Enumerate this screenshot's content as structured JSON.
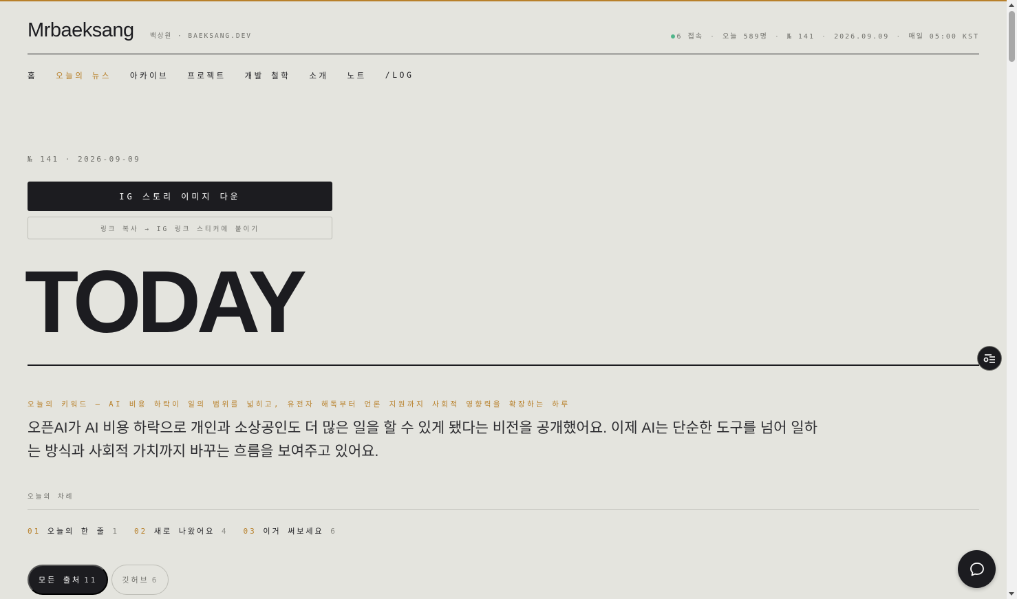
{
  "site": {
    "brand": "Mrbaeksang",
    "brand_sub": "백상원 · BAEKSANG.DEV"
  },
  "meta": {
    "online": "6 접속",
    "today_visits": "오늘 589명",
    "issue": "№ 141",
    "date": "2026.09.09",
    "schedule": "매일 05:00 KST"
  },
  "nav": [
    {
      "label": "홈",
      "active": false
    },
    {
      "label": "오늘의 뉴스",
      "active": true
    },
    {
      "label": "아카이브",
      "active": false
    },
    {
      "label": "프로젝트",
      "active": false
    },
    {
      "label": "개발 철학",
      "active": false
    },
    {
      "label": "소개",
      "active": false
    },
    {
      "label": "노트",
      "active": false
    },
    {
      "label": "/LOG",
      "active": false
    }
  ],
  "issue_line": "№ 141 · 2026-09-09",
  "buttons": {
    "ig_story": "IG 스토리 이미지 다운",
    "copy_link": "링크 복사 → IG 링크 스티커에 붙이기"
  },
  "hero": "TODAY",
  "keyword_line": "오늘의 키워드 — AI 비용 하락이 일의 범위를 넓히고, 유전자 해독부터 언론 지원까지 사회적 영향력을 확장하는 하루",
  "summary": "오픈AI가 AI 비용 하락으로 개인과 소상공인도 더 많은 일을 할 수 있게 됐다는 비전을 공개했어요. 이제 AI는 단순한 도구를 넘어 일하는 방식과 사회적 가치까지 바꾸는 흐름을 보여주고 있어요.",
  "toc": {
    "label": "오늘의 차례",
    "items": [
      {
        "num": "01",
        "title": "오늘의 한 줄",
        "count": "1"
      },
      {
        "num": "02",
        "title": "새로 나왔어요",
        "count": "4"
      },
      {
        "num": "03",
        "title": "이거 써보세요",
        "count": "6"
      }
    ]
  },
  "filters": [
    {
      "label": "모든 출처",
      "count": "11",
      "active": true
    },
    {
      "label": "깃허브",
      "count": "6",
      "active": false
    }
  ],
  "icons": {
    "filter": "filter-settings-icon",
    "chat": "chat-bubble-icon"
  },
  "colors": {
    "accent": "#b8802a",
    "background": "#e4e4de",
    "ink": "#1c1c20",
    "online_dot": "#4fb58a"
  }
}
